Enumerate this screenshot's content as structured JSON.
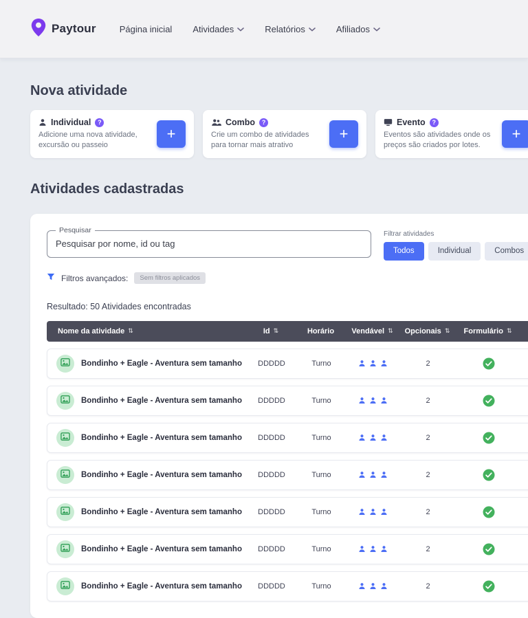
{
  "colors": {
    "accent": "#4c6ef5",
    "brand_purple": "#7c3aed",
    "header_bg": "#4b4c5a",
    "success": "#43b15d"
  },
  "navbar": {
    "brand": "Paytour",
    "items": [
      {
        "label": "Página inicial",
        "dropdown": false
      },
      {
        "label": "Atividades",
        "dropdown": true
      },
      {
        "label": "Relatórios",
        "dropdown": true
      },
      {
        "label": "Afiliados",
        "dropdown": true
      }
    ]
  },
  "new_activity": {
    "title": "Nova atividade",
    "help_badge": "?",
    "add_button_label": "+",
    "cards": [
      {
        "title": "Individual",
        "icon": "person-icon",
        "description": "Adicione uma nova atividade, excursão ou passeio"
      },
      {
        "title": "Combo",
        "icon": "people-icon",
        "description": "Crie um combo de atividades para tornar mais atrativo"
      },
      {
        "title": "Evento",
        "icon": "screen-icon",
        "description": "Eventos são atividades onde os preços são criados por lotes."
      }
    ]
  },
  "activities": {
    "title": "Atividades cadastradas",
    "search": {
      "label": "Pesquisar",
      "placeholder": "Pesquisar por nome, id ou tag"
    },
    "filter": {
      "label": "Filtrar atividades",
      "options": [
        "Todos",
        "Individual",
        "Combos"
      ],
      "active": "Todos"
    },
    "advanced": {
      "label": "Filtros avançados:",
      "badge": "Sem filtros aplicados"
    },
    "result_text": "Resultado: 50 Atividades encontradas",
    "table": {
      "columns": [
        {
          "label": "Nome da atividade",
          "sortable": true
        },
        {
          "label": "Id",
          "sortable": true
        },
        {
          "label": "Horário",
          "sortable": false
        },
        {
          "label": "Vendável",
          "sortable": true
        },
        {
          "label": "Opcionais",
          "sortable": true
        },
        {
          "label": "Formulário",
          "sortable": true
        }
      ],
      "rows": [
        {
          "name": "Bondinho + Eagle - Aventura sem tamanho",
          "id": "DDDDD",
          "horario": "Turno",
          "vendavel_count": 3,
          "opcionais": "2",
          "formulario": "ok"
        },
        {
          "name": "Bondinho + Eagle - Aventura sem tamanho",
          "id": "DDDDD",
          "horario": "Turno",
          "vendavel_count": 3,
          "opcionais": "2",
          "formulario": "ok"
        },
        {
          "name": "Bondinho + Eagle - Aventura sem tamanho",
          "id": "DDDDD",
          "horario": "Turno",
          "vendavel_count": 3,
          "opcionais": "2",
          "formulario": "ok"
        },
        {
          "name": "Bondinho + Eagle - Aventura sem tamanho",
          "id": "DDDDD",
          "horario": "Turno",
          "vendavel_count": 3,
          "opcionais": "2",
          "formulario": "ok"
        },
        {
          "name": "Bondinho + Eagle - Aventura sem tamanho",
          "id": "DDDDD",
          "horario": "Turno",
          "vendavel_count": 3,
          "opcionais": "2",
          "formulario": "ok"
        },
        {
          "name": "Bondinho + Eagle - Aventura sem tamanho",
          "id": "DDDDD",
          "horario": "Turno",
          "vendavel_count": 3,
          "opcionais": "2",
          "formulario": "ok"
        },
        {
          "name": "Bondinho + Eagle - Aventura sem tamanho",
          "id": "DDDDD",
          "horario": "Turno",
          "vendavel_count": 3,
          "opcionais": "2",
          "formulario": "ok"
        }
      ]
    }
  }
}
